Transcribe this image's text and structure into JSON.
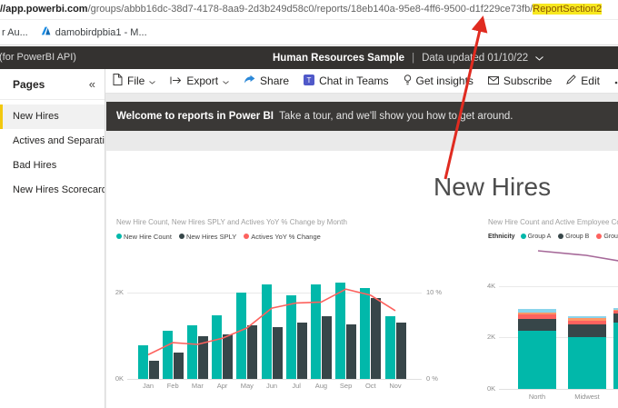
{
  "browser": {
    "url_prefix": "//app.powerbi.com",
    "url_path": "/groups/abbb16dc-38d7-4178-8aa9-2d3b249d58c0/reports/18eb140a-95e8-4ff6-9500-d1f229ce73fb/",
    "url_highlight": "ReportSection2",
    "bookmark_1": "r Au...",
    "bookmark_2": "damobirdpbia1 - M..."
  },
  "appbar": {
    "left_text": "(for PowerBI API)",
    "report_title": "Human Resources Sample",
    "separator": "|",
    "updated_text": "Data updated 01/10/22"
  },
  "toolbar": {
    "pages_label": "Pages",
    "collapse_glyph": "«",
    "file": "File",
    "export": "Export",
    "share": "Share",
    "chat": "Chat in Teams",
    "insights": "Get insights",
    "subscribe": "Subscribe",
    "edit": "Edit"
  },
  "sidebar": {
    "accent_color": "#F2C80F",
    "items": [
      {
        "label": "New Hires",
        "selected": true
      },
      {
        "label": "Actives and Separations",
        "selected": false
      },
      {
        "label": "Bad Hires",
        "selected": false
      },
      {
        "label": "New Hires Scorecard",
        "selected": false
      }
    ]
  },
  "banner": {
    "bold": "Welcome to reports in Power BI",
    "text": "Take a tour, and we'll show you how to get around."
  },
  "page": {
    "title": "New Hires"
  },
  "annotation": {
    "arrow_color": "#e02b20",
    "highlight_color": "#f7e81f"
  },
  "chart_data": [
    {
      "type": "bar",
      "title": "New Hire Count, New Hires SPLY and Actives YoY % Change by Month",
      "categories": [
        "Jan",
        "Feb",
        "Mar",
        "Apr",
        "May",
        "Jun",
        "Jul",
        "Aug",
        "Sep",
        "Oct",
        "Nov"
      ],
      "series": [
        {
          "name": "New Hire Count",
          "type": "bar",
          "color": "#01B8AA",
          "values": [
            0.78,
            1.12,
            1.24,
            1.47,
            2.0,
            2.19,
            1.94,
            2.19,
            2.23,
            2.11,
            1.45
          ]
        },
        {
          "name": "New Hires SPLY",
          "type": "bar",
          "color": "#374649",
          "values": [
            0.42,
            0.61,
            0.99,
            1.03,
            1.24,
            1.2,
            1.31,
            1.45,
            1.26,
            1.87,
            1.3
          ]
        },
        {
          "name": "Actives YoY % Change",
          "type": "line",
          "axis": "right",
          "color": "#FD625E",
          "values": [
            2.8,
            4.2,
            4.0,
            4.7,
            5.9,
            8.2,
            8.8,
            8.9,
            10.4,
            9.7,
            7.9
          ]
        }
      ],
      "y_left": {
        "ticks": [
          "0K",
          "2K"
        ],
        "unit": "K",
        "max": 2.3
      },
      "y_right": {
        "ticks": [
          "0 %",
          "10 %"
        ],
        "unit": "%",
        "max": 10.4
      },
      "grid": true,
      "legend_position": "top"
    },
    {
      "type": "stacked-bar",
      "title": "New Hire Count and Active Employee Cou",
      "legend_title": "Ethnicity",
      "legend": [
        {
          "name": "Group A",
          "color": "#01B8AA"
        },
        {
          "name": "Group B",
          "color": "#374649"
        },
        {
          "name": "Group C",
          "color": "#FD625E"
        },
        {
          "name": "",
          "color": "#F2C80F"
        }
      ],
      "categories": [
        "North",
        "Midwest",
        ""
      ],
      "segment_colors": [
        "#01B8AA",
        "#374649",
        "#FD625E",
        "#FE9666",
        "#8AD4EB"
      ],
      "stacks": [
        [
          2.27,
          0.46,
          0.18,
          0.07,
          0.14
        ],
        [
          2.02,
          0.5,
          0.15,
          0.08,
          0.09
        ],
        [
          2.6,
          0.35,
          0.1,
          0.05,
          0.05
        ]
      ],
      "line": {
        "name": "Active Employee Count",
        "color": "#A66999",
        "values": [
          5.35,
          5.2,
          4.9
        ]
      },
      "y_left": {
        "ticks": [
          "0K",
          "2K",
          "4K"
        ],
        "unit": "K",
        "max": 5.4
      },
      "grid": true,
      "legend_position": "top"
    }
  ]
}
